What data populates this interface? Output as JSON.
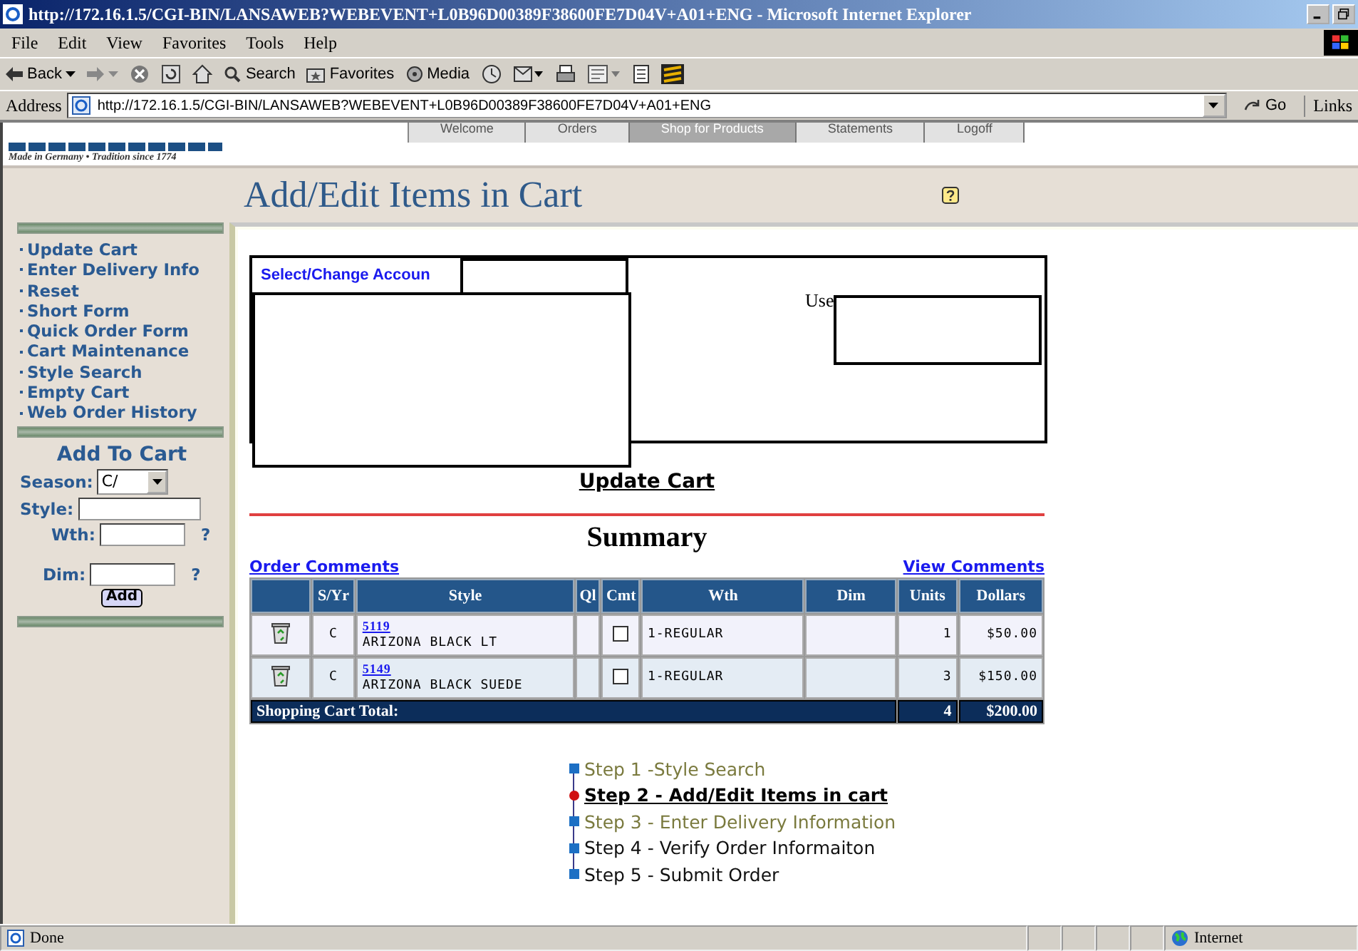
{
  "window": {
    "title": "http://172.16.1.5/CGI-BIN/LANSAWEB?WEBEVENT+L0B96D00389F38600FE7D04V+A01+ENG - Microsoft Internet Explorer"
  },
  "menu": [
    "File",
    "Edit",
    "View",
    "Favorites",
    "Tools",
    "Help"
  ],
  "toolbar": {
    "back": "Back",
    "search": "Search",
    "favorites": "Favorites",
    "media": "Media"
  },
  "address": {
    "label": "Address",
    "url": "http://172.16.1.5/CGI-BIN/LANSAWEB?WEBEVENT+L0B96D00389F38600FE7D04V+A01+ENG",
    "go": "Go",
    "links": "Links"
  },
  "site": {
    "tagline": "Made in Germany • Tradition since 1774",
    "nav": [
      {
        "label": "Welcome",
        "selected": false
      },
      {
        "label": "Orders",
        "selected": false
      },
      {
        "label": "Shop for Products",
        "selected": true
      },
      {
        "label": "Statements",
        "selected": false
      },
      {
        "label": "Logoff",
        "selected": false
      }
    ]
  },
  "page_title": "Add/Edit Items in Cart",
  "sidebar": {
    "links": [
      "Update Cart",
      "Enter Delivery Info",
      "Reset",
      "Short Form",
      "Quick Order Form",
      "Cart Maintenance",
      "Style Search",
      "Empty Cart",
      "Web Order History"
    ],
    "add_to_cart": {
      "title": "Add To Cart",
      "season_label": "Season:",
      "season_value": "C/",
      "style_label": "Style:",
      "wth_label": "Wth:",
      "dim_label": "Dim:",
      "help": "?",
      "add_button": "Add"
    }
  },
  "account": {
    "tab": "Select/Change Accoun",
    "user_label": "Use"
  },
  "update_cart": "Update Cart",
  "summary": {
    "title": "Summary",
    "order_comments": "Order Comments",
    "view_comments": "View Comments",
    "columns": [
      "S/Yr",
      "Style",
      "Ql",
      "Cmt",
      "Wth",
      "Dim",
      "Units",
      "Dollars"
    ],
    "rows": [
      {
        "season": "C",
        "style_code": "5119",
        "style_name": "ARIZONA BLACK LT",
        "comment": false,
        "wth": "1-REGULAR",
        "units": "1",
        "dollars": "$50.00"
      },
      {
        "season": "C",
        "style_code": "5149",
        "style_name": "ARIZONA BLACK SUEDE",
        "comment": false,
        "wth": "1-REGULAR",
        "units": "3",
        "dollars": "$150.00"
      }
    ],
    "total": {
      "label": "Shopping Cart Total:",
      "units": "4",
      "dollars": "$200.00"
    }
  },
  "steps": [
    {
      "label": "Step 1 -Style  Search",
      "kind": "done"
    },
    {
      "label": "Step 2 - Add/Edit Items in cart",
      "kind": "current"
    },
    {
      "label": "Step 3 - Enter Delivery Information",
      "kind": "done"
    },
    {
      "label": "Step 4 - Verify Order Informaiton",
      "kind": "pending"
    },
    {
      "label": "Step 5 - Submit Order",
      "kind": "pending"
    }
  ],
  "status_bar": {
    "text": "Done",
    "zone": "Internet"
  }
}
